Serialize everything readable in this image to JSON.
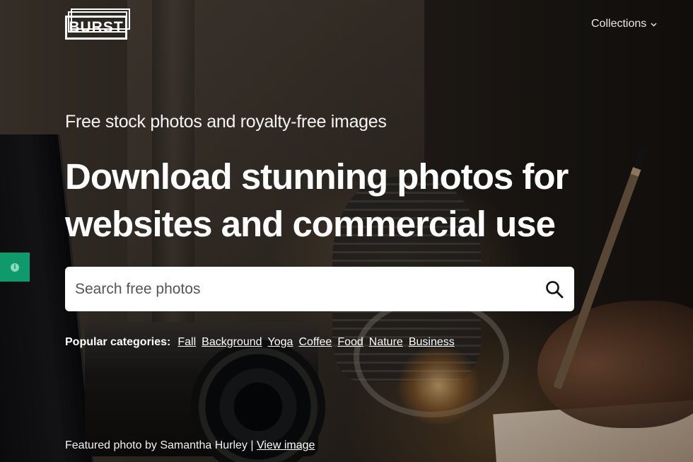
{
  "header": {
    "logo_text": "BURST",
    "collections_label": "Collections",
    "collections_icon": "chevron-down-icon"
  },
  "hero": {
    "tagline": "Free stock photos and royalty-free images",
    "headline_line1": "Download stunning photos for",
    "headline_line2": "websites and commercial use"
  },
  "search": {
    "placeholder": "Search free photos",
    "value": "",
    "icon": "search-icon"
  },
  "categories": {
    "label": "Popular categories:",
    "items": [
      "Fall",
      "Background",
      "Yoga",
      "Coffee",
      "Food",
      "Nature",
      "Business"
    ]
  },
  "feedback": {
    "icon": "info-icon",
    "icon_glyph": "i",
    "color": "#0f9a6b"
  },
  "credit": {
    "text": "Featured photo by Samantha Hurley |",
    "link_label": "View image"
  }
}
